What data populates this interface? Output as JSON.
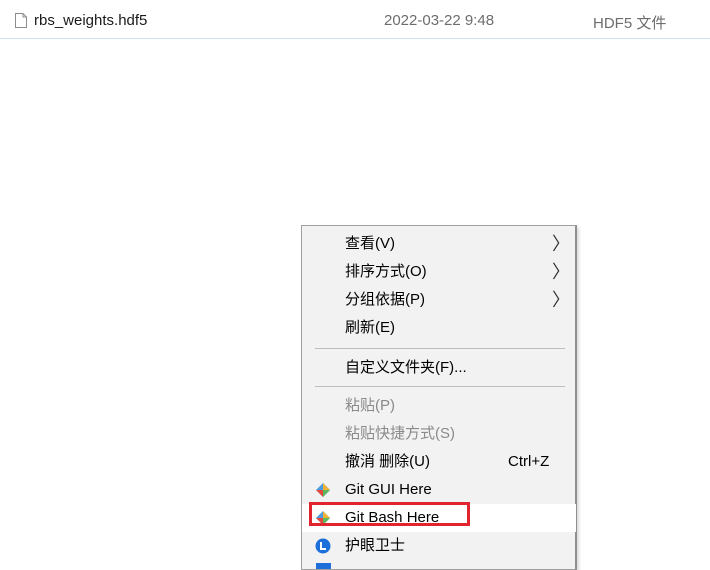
{
  "file": {
    "name": "rbs_weights.hdf5",
    "date": "2022-03-22 9:48",
    "type": "HDF5 文件"
  },
  "context_menu": {
    "items": [
      {
        "label": "查看(V)",
        "submenu": true,
        "enabled": true
      },
      {
        "label": "排序方式(O)",
        "submenu": true,
        "enabled": true
      },
      {
        "label": "分组依据(P)",
        "submenu": true,
        "enabled": true
      },
      {
        "label": "刷新(E)",
        "enabled": true
      },
      {
        "label": "自定义文件夹(F)...",
        "enabled": true
      },
      {
        "label": "粘贴(P)",
        "enabled": false
      },
      {
        "label": "粘贴快捷方式(S)",
        "enabled": false
      },
      {
        "label": "撤消 删除(U)",
        "shortcut": "Ctrl+Z",
        "enabled": true
      },
      {
        "label": "Git GUI Here",
        "icon": "git-icon",
        "enabled": true
      },
      {
        "label": "Git Bash Here",
        "icon": "git-icon",
        "enabled": true,
        "highlighted": true
      },
      {
        "label": "护眼卫士",
        "icon": "eye-guard-icon",
        "enabled": true
      }
    ],
    "arrow_glyph": "〉"
  },
  "colors": {
    "highlight_border": "#e0252f",
    "menu_background": "#f2f2f2",
    "eye_guard_blue": "#1e6fd9"
  }
}
